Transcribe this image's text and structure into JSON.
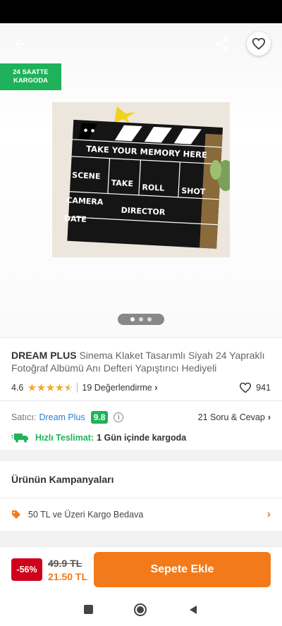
{
  "badge": {
    "line1": "24 SAATTE",
    "line2": "KARGODA"
  },
  "image": {
    "clapper_title": "TAKE YOUR MEMORY HERE",
    "cells": [
      "SCENE",
      "TAKE",
      "ROLL",
      "SHOT",
      "CAMERA",
      "DIRECTOR",
      "DATE"
    ]
  },
  "product": {
    "brand": "DREAM PLUS",
    "name": "Sinema Klaket Tasarımlı Siyah 24 Yapraklı Fotoğraf Albümü Anı Defteri Yapıştırıcı Hediyeli",
    "rating": "4.6",
    "rating_fill": 4.6,
    "reviews": "19 Değerlendirme",
    "favorites": "941"
  },
  "seller": {
    "label": "Satıcı:",
    "name": "Dream Plus",
    "score": "9.8",
    "qa": "21 Soru & Cevap"
  },
  "delivery": {
    "label": "Hızlı Teslimat:",
    "value": "1 Gün içinde kargoda"
  },
  "campaigns": {
    "title": "Ürünün Kampanyaları",
    "item": "50 TL ve Üzeri Kargo Bedava"
  },
  "purchase": {
    "discount": "-56%",
    "old_price": "49.9 TL",
    "new_price": "21.50 TL",
    "cart_label": "Sepete Ekle"
  },
  "colors": {
    "accent": "#f27a1a",
    "green": "#1fb25a",
    "red": "#d0021b",
    "link": "#2a7fd4"
  }
}
